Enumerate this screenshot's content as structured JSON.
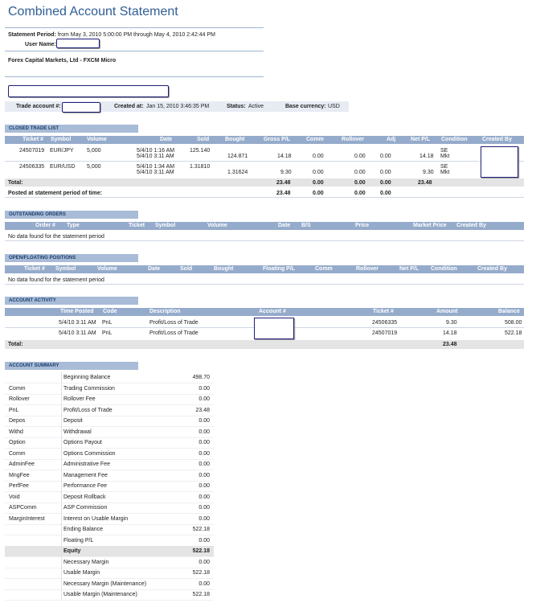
{
  "title": "Combined Account Statement",
  "statement_period": {
    "label": "Statement Period:",
    "value": "from May 3, 2010 5:00:00 PM through May 4, 2010 2:42:44 PM"
  },
  "user_name_label": "User Name:",
  "company": "Forex Capital Markets, Ltd - FXCM Micro",
  "info": {
    "trade_account_label": "Trade account #:",
    "created_at_label": "Created at:",
    "created_at_value": "Jan 15, 2010 3:46:35 PM",
    "status_label": "Status:",
    "status_value": "Active",
    "base_currency_label": "Base currency:",
    "base_currency_value": "USD"
  },
  "closed": {
    "section": "CLOSED TRADE LIST",
    "headers": [
      "Ticket #",
      "Symbol",
      "Volume",
      "Date",
      "Sold",
      "Bought",
      "Gross P/L",
      "Comm",
      "Rollover",
      "Adj",
      "Net P/L",
      "Condition",
      "Created By"
    ],
    "rows": [
      {
        "ticket": "24507019",
        "symbol": "EUR/JPY",
        "volume": "5,000",
        "date1": "5/4/10 1:16 AM",
        "date2": "5/4/10 3:11 AM",
        "sold": "125.140",
        "bought": "124.871",
        "gross": "14.18",
        "comm": "0.00",
        "rollover": "0.00",
        "adj": "0.00",
        "net": "14.18",
        "cond1": "SE",
        "cond2": "Mkt"
      },
      {
        "ticket": "24506335",
        "symbol": "EUR/USD",
        "volume": "5,000",
        "date1": "5/4/10 1:34 AM",
        "date2": "5/4/10 3:11 AM",
        "sold": "1.31810",
        "bought": "1.31624",
        "gross": "9.30",
        "comm": "0.00",
        "rollover": "0.00",
        "adj": "0.00",
        "net": "9.30",
        "cond1": "SE",
        "cond2": "Mkt"
      }
    ],
    "total_label": "Total:",
    "total": {
      "gross": "23.48",
      "comm": "0.00",
      "rollover": "0.00",
      "adj": "0.00",
      "net": "23.48"
    },
    "posted_label": "Posted at statement period of time:",
    "posted": {
      "gross": "23.48",
      "comm": "0.00",
      "rollover": "0.00",
      "adj": "0.00"
    }
  },
  "outstanding": {
    "section": "OUTSTANDING ORDERS",
    "headers": [
      "Order #",
      "Type",
      "Ticket",
      "Symbol",
      "Volume",
      "Date",
      "B/S",
      "Price",
      "Market Price",
      "Created By"
    ],
    "empty": "No data found for the statement period"
  },
  "open": {
    "section": "OPEN/FLOATING POSITIONS",
    "headers": [
      "Ticket #",
      "Symbol",
      "Volume",
      "Date",
      "Sold",
      "Bought",
      "Floating P/L",
      "Comm",
      "Rollover",
      "Net P/L",
      "Condition",
      "Created By"
    ],
    "empty": "No data found for the statement period"
  },
  "activity": {
    "section": "ACCOUNT ACTIVITY",
    "headers": [
      "Time Posted",
      "Code",
      "Description",
      "Account #",
      "Ticket #",
      "Amount",
      "Balance"
    ],
    "rows": [
      {
        "time": "5/4/10 3:11 AM",
        "code": "PnL",
        "desc": "Profit/Loss of Trade",
        "ticket": "24506335",
        "amount": "9.30",
        "balance": "508.00"
      },
      {
        "time": "5/4/10 3:11 AM",
        "code": "PnL",
        "desc": "Profit/Loss of Trade",
        "ticket": "24507019",
        "amount": "14.18",
        "balance": "522.18"
      }
    ],
    "total_label": "Total:",
    "total_amount": "23.48"
  },
  "summary": {
    "section": "ACCOUNT SUMMARY",
    "rows": [
      {
        "code": "",
        "name": "Beginning Balance",
        "value": "498.70"
      },
      {
        "code": "Comm",
        "name": "Trading Commission",
        "value": "0.00"
      },
      {
        "code": "Rollover",
        "name": "Rollover Fee",
        "value": "0.00"
      },
      {
        "code": "PnL",
        "name": "Profit/Loss of Trade",
        "value": "23.48"
      },
      {
        "code": "Depos",
        "name": "Deposit",
        "value": "0.00"
      },
      {
        "code": "Withd",
        "name": "Withdrawal",
        "value": "0.00"
      },
      {
        "code": "Option",
        "name": "Options Payout",
        "value": "0.00"
      },
      {
        "code": "Comm",
        "name": "Options Commission",
        "value": "0.00"
      },
      {
        "code": "AdminFee",
        "name": "Administrative Fee",
        "value": "0.00"
      },
      {
        "code": "MngFee",
        "name": "Management Fee",
        "value": "0.00"
      },
      {
        "code": "PerfFee",
        "name": "Performance Fee",
        "value": "0.00"
      },
      {
        "code": "Void",
        "name": "Deposit Rollback",
        "value": "0.00"
      },
      {
        "code": "ASPComm",
        "name": "ASP Commission",
        "value": "0.00"
      },
      {
        "code": "MarginInterest",
        "name": "Interest on Usable Margin",
        "value": "0.00"
      },
      {
        "code": "",
        "name": "Ending Balance",
        "value": "522.18"
      },
      {
        "code": "",
        "name": "Floating P/L",
        "value": "0.00"
      },
      {
        "code": "",
        "name": "Equity",
        "value": "522.18"
      },
      {
        "code": "",
        "name": "Necessary Margin",
        "value": "0.00"
      },
      {
        "code": "",
        "name": "Usable Margin",
        "value": "522.18"
      },
      {
        "code": "",
        "name": "Necessary Margin (Maintenance)",
        "value": "0.00"
      },
      {
        "code": "",
        "name": "Usable Margin (Maintenance)",
        "value": "522.18"
      }
    ]
  }
}
